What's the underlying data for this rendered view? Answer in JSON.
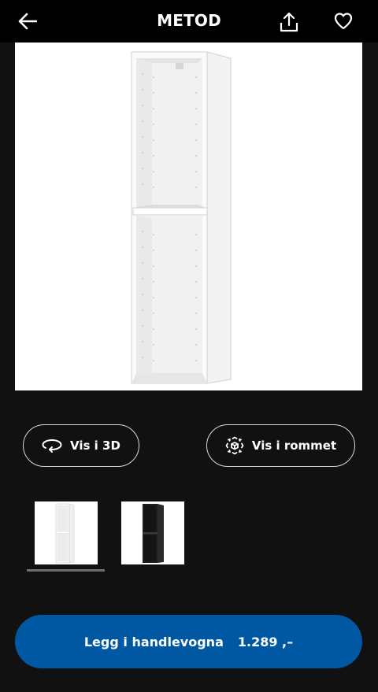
{
  "header": {
    "title": "METOD",
    "back_icon": "arrow-left-icon",
    "share_icon": "share-icon",
    "favorite_icon": "heart-icon"
  },
  "hero": {
    "product_variant": "white",
    "image": "cabinet-frame-white"
  },
  "actions": {
    "view_3d_label": "Vis i 3D",
    "view_3d_icon": "rotate-3d-icon",
    "view_room_label": "Vis i rommet",
    "view_room_icon": "ar-cube-icon"
  },
  "thumbnails": [
    {
      "variant": "white",
      "selected": true
    },
    {
      "variant": "black",
      "selected": false
    }
  ],
  "cart": {
    "label": "Legg i handlevogna",
    "price": "1.289 ,–"
  },
  "colors": {
    "background": "#111111",
    "topbar": "#000000",
    "accent": "#0058a3",
    "pill_border": "#d9d9d9"
  }
}
